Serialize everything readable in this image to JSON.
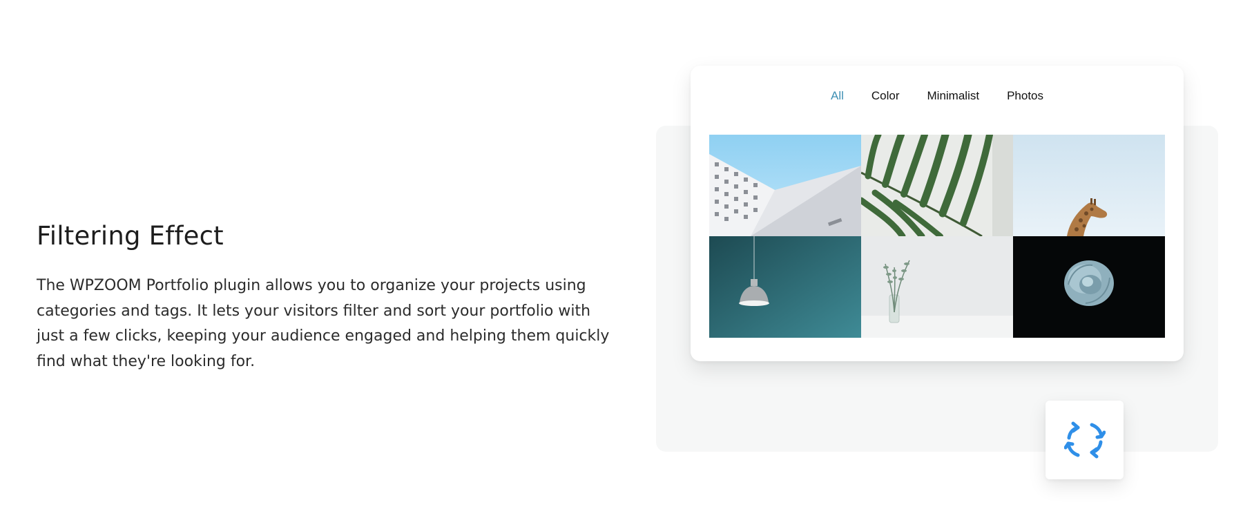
{
  "feature": {
    "title": "Filtering Effect",
    "description": "The WPZOOM Portfolio plugin allows you to organize your projects using categories and tags. It lets your visitors filter and sort your portfolio with just a few clicks, keeping your audience engaged and helping them quickly find what they're looking for."
  },
  "portfolio": {
    "filters": [
      {
        "label": "All",
        "active": true
      },
      {
        "label": "Color",
        "active": false
      },
      {
        "label": "Minimalist",
        "active": false
      },
      {
        "label": "Photos",
        "active": false
      }
    ],
    "tiles": [
      {
        "subject": "white-building-sky"
      },
      {
        "subject": "palm-leaf"
      },
      {
        "subject": "giraffe-sky"
      },
      {
        "subject": "pendant-lamp-teal"
      },
      {
        "subject": "plant-in-vase"
      },
      {
        "subject": "blue-rose-dark"
      }
    ]
  },
  "icons": {
    "refresh": "refresh-arrows-icon"
  },
  "colors": {
    "accent_filter": "#3d8fb3",
    "icon_blue": "#2f8fe8",
    "demo_background": "#f6f7f7"
  }
}
